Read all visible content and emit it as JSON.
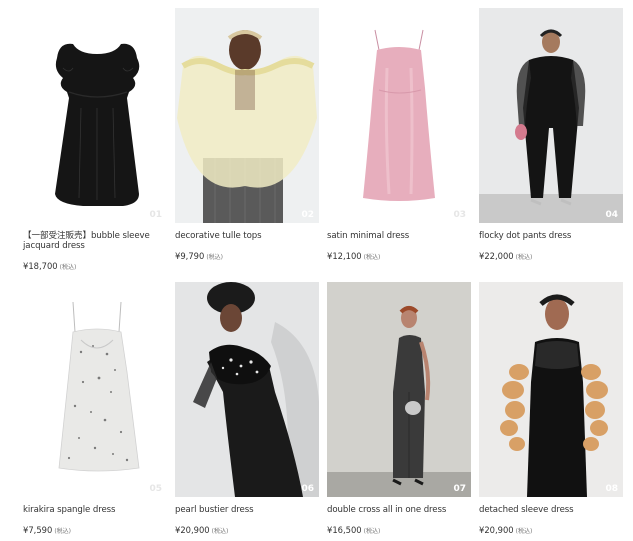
{
  "products": [
    {
      "name": "【一部受注販売】bubble sleeve jacquard dress",
      "price": "¥18,700",
      "tax": "(税込)",
      "num": "01",
      "icon": "black-bubble-sleeve-dress-image"
    },
    {
      "name": "decorative tulle tops",
      "price": "¥9,790",
      "tax": "(税込)",
      "num": "02",
      "icon": "model-tulle-tops-image"
    },
    {
      "name": "satin minimal dress",
      "price": "¥12,100",
      "tax": "(税込)",
      "num": "03",
      "icon": "pink-satin-dress-image"
    },
    {
      "name": "flocky dot pants dress",
      "price": "¥22,000",
      "tax": "(税込)",
      "num": "04",
      "icon": "model-black-pants-dress-image"
    },
    {
      "name": "kirakira spangle dress",
      "price": "¥7,590",
      "tax": "(税込)",
      "num": "05",
      "icon": "white-spangle-dress-image"
    },
    {
      "name": "pearl bustier dress",
      "price": "¥20,900",
      "tax": "(税込)",
      "num": "06",
      "icon": "model-pearl-bustier-dress-image"
    },
    {
      "name": "double cross all in one dress",
      "price": "¥16,500",
      "tax": "(税込)",
      "num": "07",
      "icon": "model-grey-all-in-one-image"
    },
    {
      "name": "detached sleeve dress",
      "price": "¥20,900",
      "tax": "(税込)",
      "num": "08",
      "icon": "model-detached-sleeve-dress-image"
    }
  ]
}
